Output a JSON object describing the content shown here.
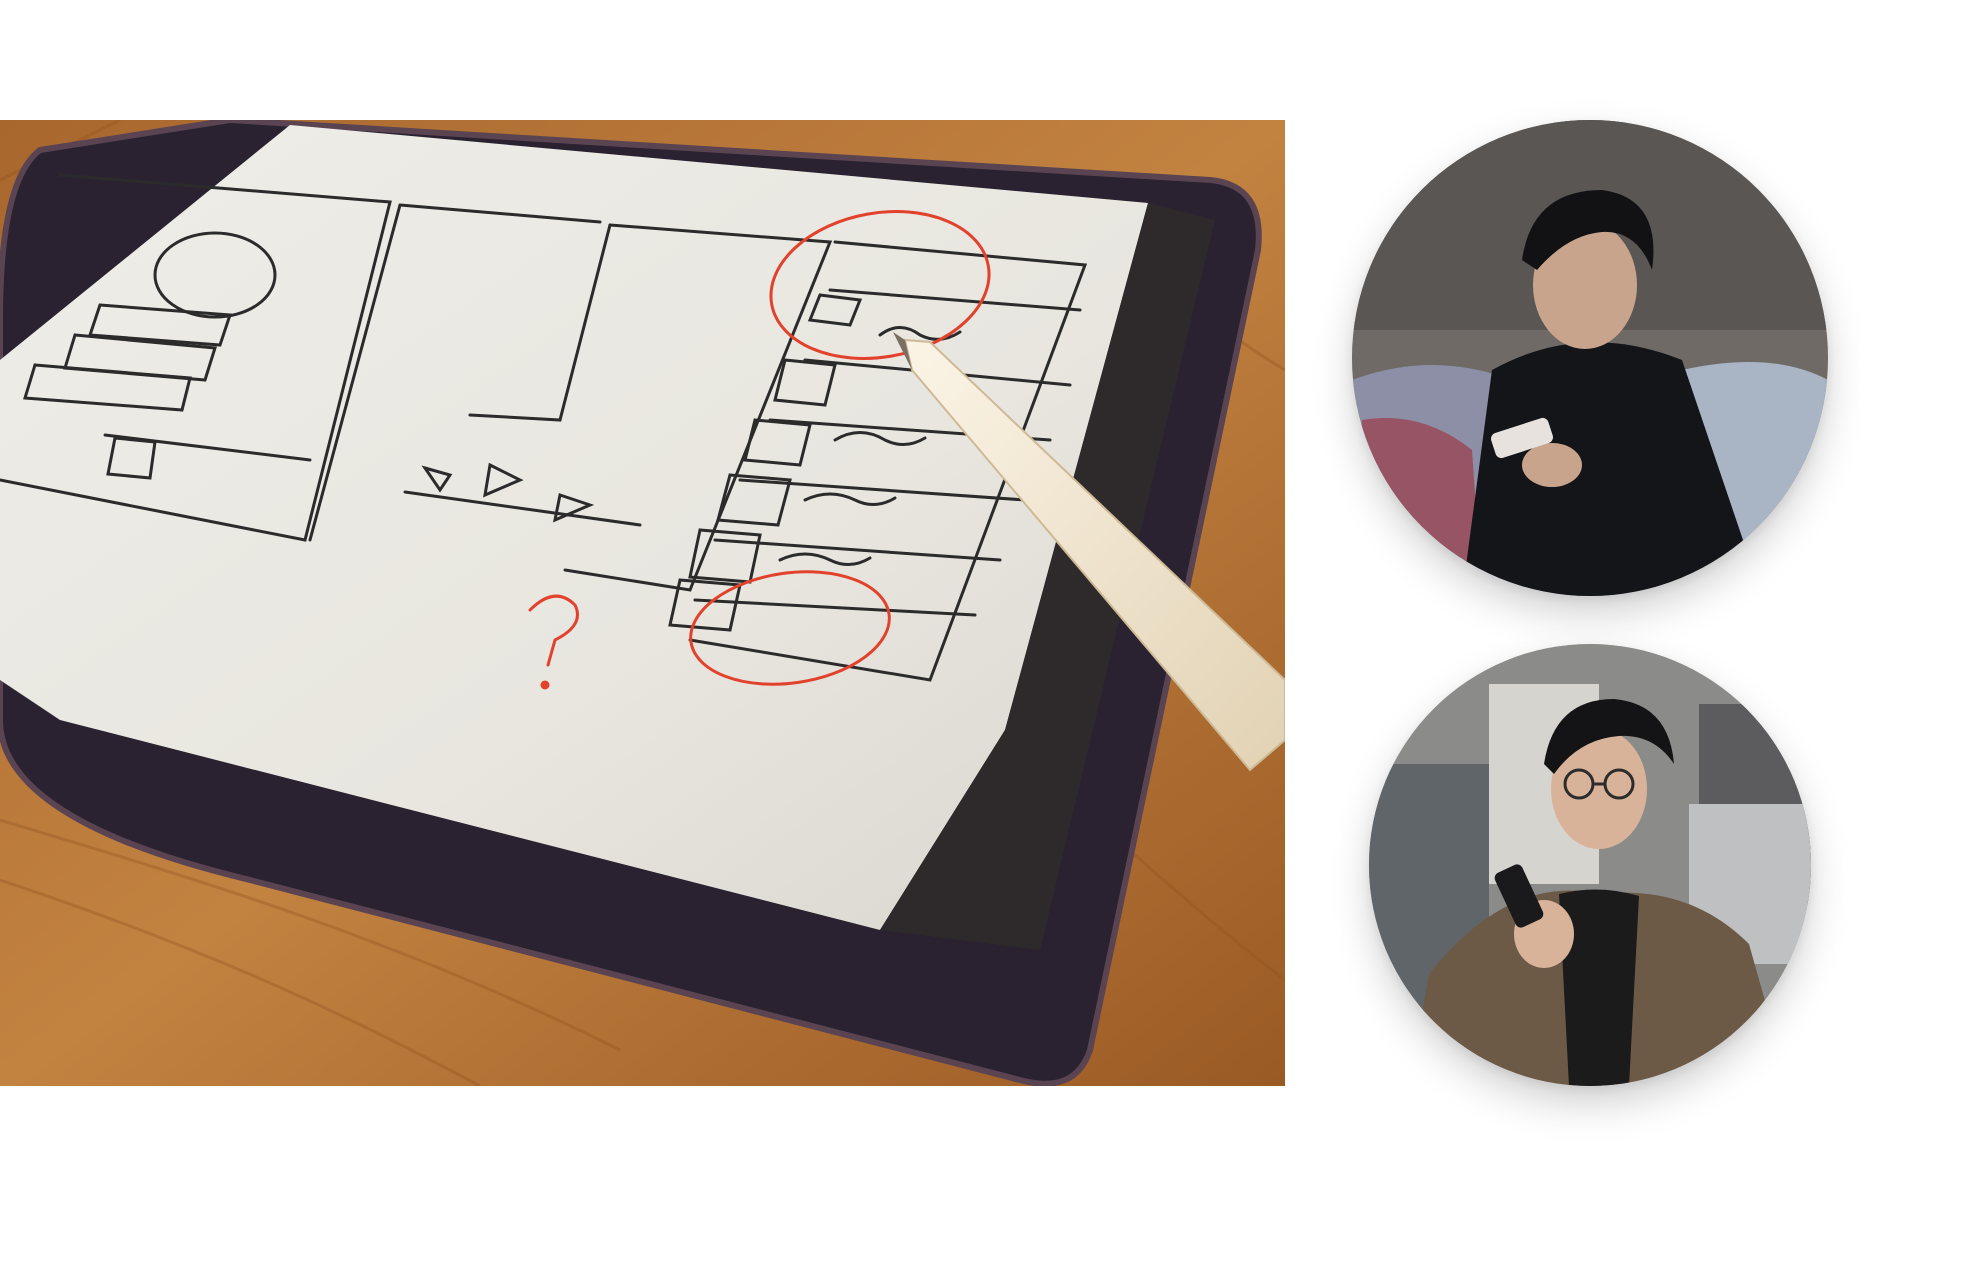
{
  "photo": {
    "subject": "tablet-wireframe-sketch",
    "colors": {
      "wood": "#b9783a",
      "bezel": "#2a2230",
      "screen": "#e9e7e1",
      "ink": "#2b2b2b",
      "red": "#e2412b",
      "pencil": "#f1e6d2"
    }
  },
  "portraits": [
    {
      "subject": "person-looking-at-phone",
      "colors": {
        "bg": "#6f6a66",
        "jacket": "#141519",
        "skin": "#c9a48d"
      }
    },
    {
      "subject": "person-with-glasses-holding-phone",
      "colors": {
        "bg": "#8b8b8a",
        "jacket": "#6d5a46",
        "skin": "#d8b39a"
      }
    }
  ]
}
